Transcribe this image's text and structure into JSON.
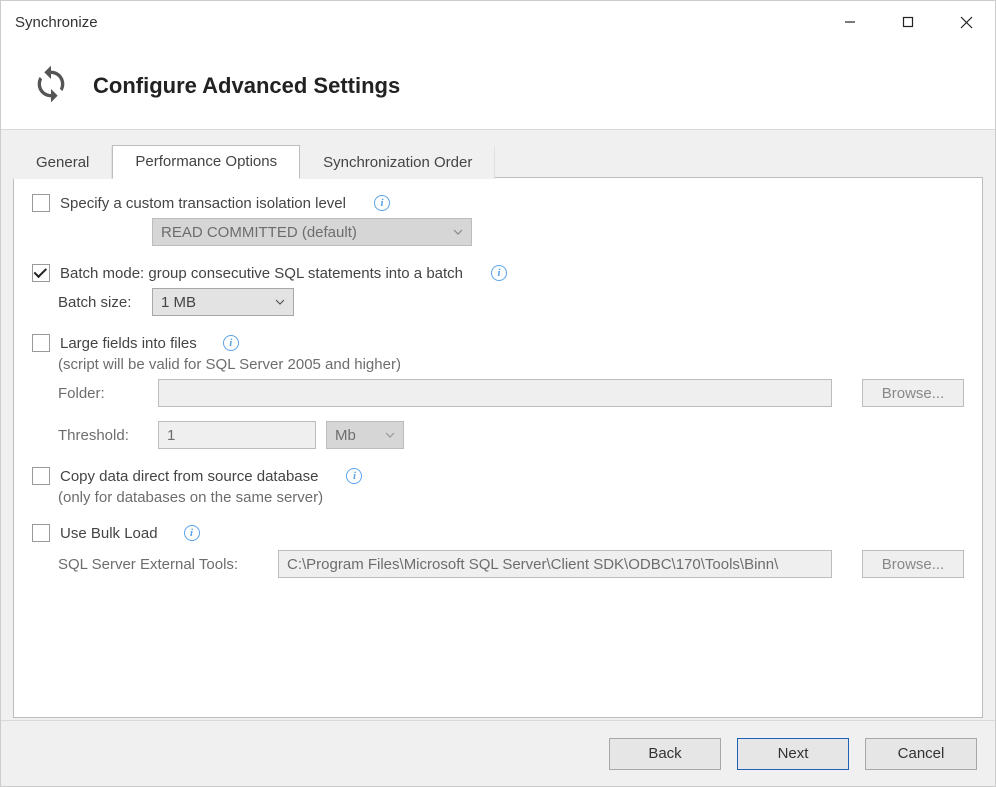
{
  "window": {
    "title": "Synchronize"
  },
  "header": {
    "title": "Configure Advanced Settings"
  },
  "tabs": {
    "general": "General",
    "performance": "Performance Options",
    "syncorder": "Synchronization Order"
  },
  "form": {
    "isolation": {
      "label": "Specify a custom transaction isolation level",
      "value": "READ COMMITTED (default)"
    },
    "batchmode": {
      "label": "Batch mode: group consecutive SQL statements into a batch",
      "size_label": "Batch size:",
      "size_value": "1 MB"
    },
    "largefields": {
      "label": "Large fields into files",
      "note": "(script will be valid for SQL Server 2005 and higher)",
      "folder_label": "Folder:",
      "folder_value": "",
      "browse_label": "Browse...",
      "threshold_label": "Threshold:",
      "threshold_value": "1",
      "threshold_unit": "Mb"
    },
    "copydirect": {
      "label": "Copy data direct from source database",
      "note": "(only for databases on the same server)"
    },
    "bulkload": {
      "label": "Use Bulk Load",
      "tools_label": "SQL Server External Tools:",
      "tools_value": "C:\\Program Files\\Microsoft SQL Server\\Client SDK\\ODBC\\170\\Tools\\Binn\\",
      "browse_label": "Browse..."
    }
  },
  "footer": {
    "back": "Back",
    "next": "Next",
    "cancel": "Cancel"
  }
}
